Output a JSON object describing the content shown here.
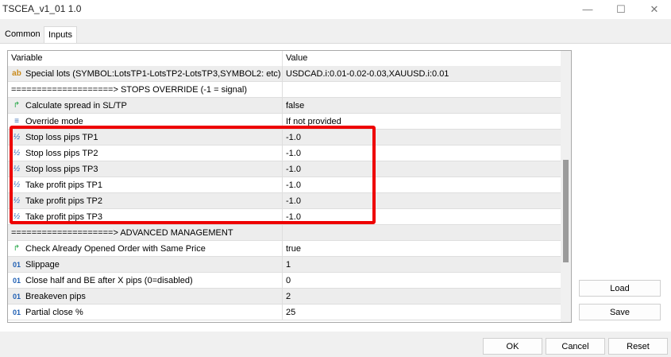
{
  "window": {
    "title": "TSCEA_v1_01 1.0",
    "minimize_glyph": "—",
    "maximize_glyph": "☐",
    "close_glyph": "✕"
  },
  "tabs": [
    {
      "label": "Common",
      "active": false
    },
    {
      "label": "Inputs",
      "active": true
    }
  ],
  "grid": {
    "headers": {
      "variable": "Variable",
      "value": "Value"
    },
    "rows": [
      {
        "icon": "ab",
        "icon_name": "string-type-icon",
        "name": "Special lots (SYMBOL:LotsTP1-LotsTP2-LotsTP3,SYMBOL2: etc)",
        "value": "USDCAD.i:0.01-0.02-0.03,XAUUSD.i:0.01"
      },
      {
        "icon": "",
        "icon_name": "",
        "name": "====================> STOPS OVERRIDE (-1 = signal)",
        "value": ""
      },
      {
        "icon": "↱",
        "icon_name": "bool-type-icon",
        "name": "Calculate spread in SL/TP",
        "value": "false"
      },
      {
        "icon": "≡",
        "icon_name": "enum-type-icon",
        "name": "Override mode",
        "value": "If not provided"
      },
      {
        "icon": "½",
        "icon_name": "double-type-icon",
        "name": "Stop loss pips TP1",
        "value": "-1.0"
      },
      {
        "icon": "½",
        "icon_name": "double-type-icon",
        "name": "Stop loss pips TP2",
        "value": "-1.0"
      },
      {
        "icon": "½",
        "icon_name": "double-type-icon",
        "name": "Stop loss pips TP3",
        "value": "-1.0"
      },
      {
        "icon": "½",
        "icon_name": "double-type-icon",
        "name": "Take profit pips TP1",
        "value": "-1.0"
      },
      {
        "icon": "½",
        "icon_name": "double-type-icon",
        "name": "Take profit pips TP2",
        "value": "-1.0"
      },
      {
        "icon": "½",
        "icon_name": "double-type-icon",
        "name": "Take profit pips TP3",
        "value": "-1.0"
      },
      {
        "icon": "",
        "icon_name": "",
        "name": "====================> ADVANCED MANAGEMENT",
        "value": ""
      },
      {
        "icon": "↱",
        "icon_name": "bool-type-icon",
        "name": "Check Already Opened Order with Same Price",
        "value": "true"
      },
      {
        "icon": "01",
        "icon_name": "int-type-icon",
        "name": "Slippage",
        "value": "1"
      },
      {
        "icon": "01",
        "icon_name": "int-type-icon",
        "name": "Close half and BE after X pips (0=disabled)",
        "value": "0"
      },
      {
        "icon": "01",
        "icon_name": "int-type-icon",
        "name": "Breakeven pips",
        "value": "2"
      },
      {
        "icon": "01",
        "icon_name": "int-type-icon",
        "name": "Partial close %",
        "value": "25"
      }
    ]
  },
  "side_buttons": {
    "load": "Load",
    "save": "Save"
  },
  "bottom_buttons": {
    "ok": "OK",
    "cancel": "Cancel",
    "reset": "Reset"
  },
  "colors": {
    "highlight": "#ee0000",
    "alt_row": "#ededed"
  }
}
